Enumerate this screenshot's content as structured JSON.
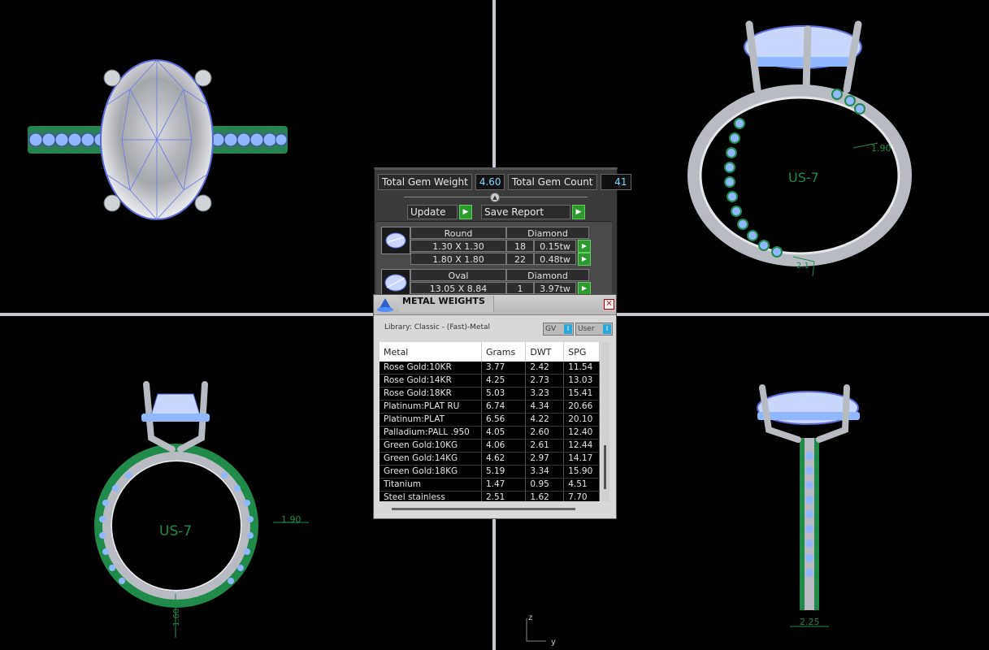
{
  "app": {
    "gem_panel": {
      "total_weight_label": "Total Gem Weight",
      "total_weight_value": "4.60",
      "total_count_label": "Total Gem Count",
      "total_count_value": "41",
      "update_label": "Update",
      "save_report_label": "Save Report",
      "groups": [
        {
          "shape": "Round",
          "material": "Diamond",
          "rows": [
            {
              "size": "1.30 X 1.30",
              "count": "18",
              "weight": "0.15tw"
            },
            {
              "size": "1.80 X 1.80",
              "count": "22",
              "weight": "0.48tw"
            }
          ]
        },
        {
          "shape": "Oval",
          "material": "Diamond",
          "rows": [
            {
              "size": "13.05 X 8.84",
              "count": "1",
              "weight": "3.97tw"
            }
          ]
        }
      ]
    },
    "metal_panel": {
      "title": "METAL WEIGHTS",
      "library": "Library: Classic - (Fast)-Metal",
      "toggle_gv": "GV",
      "toggle_user": "User",
      "columns": [
        "Metal",
        "Grams",
        "DWT",
        "SPG"
      ],
      "rows": [
        [
          "Rose Gold:10KR",
          "3.77",
          "2.42",
          "11.54"
        ],
        [
          "Rose Gold:14KR",
          "4.25",
          "2.73",
          "13.03"
        ],
        [
          "Rose Gold:18KR",
          "5.03",
          "3.23",
          "15.41"
        ],
        [
          "Platinum:PLAT RU",
          "6.74",
          "4.34",
          "20.66"
        ],
        [
          "Platinum:PLAT",
          "6.56",
          "4.22",
          "20.10"
        ],
        [
          "Palladium:PALL .950",
          "4.05",
          "2.60",
          "12.40"
        ],
        [
          "Green Gold:10KG",
          "4.06",
          "2.61",
          "12.44"
        ],
        [
          "Green Gold:14KG",
          "4.62",
          "2.97",
          "14.17"
        ],
        [
          "Green Gold:18KG",
          "5.19",
          "3.34",
          "15.90"
        ],
        [
          "Titanium",
          "1.47",
          "0.95",
          "4.51"
        ],
        [
          "Steel stainless",
          "2.51",
          "1.62",
          "7.70"
        ]
      ]
    },
    "viewports": {
      "ring_size_label": "US-7",
      "dim_shank_top": "1.90",
      "dim_shank_bottom": "1.60",
      "dim_side_width": "2.25",
      "dim_side_bottom_tr": "2.1",
      "axis_z": "z",
      "axis_y": "y"
    },
    "colors": {
      "gem_blue": "#8fb8ff",
      "metal_gray": "#b8bcc2",
      "dimension_green": "#1f8a4a",
      "accent_cyan": "#7fd7ff"
    }
  }
}
